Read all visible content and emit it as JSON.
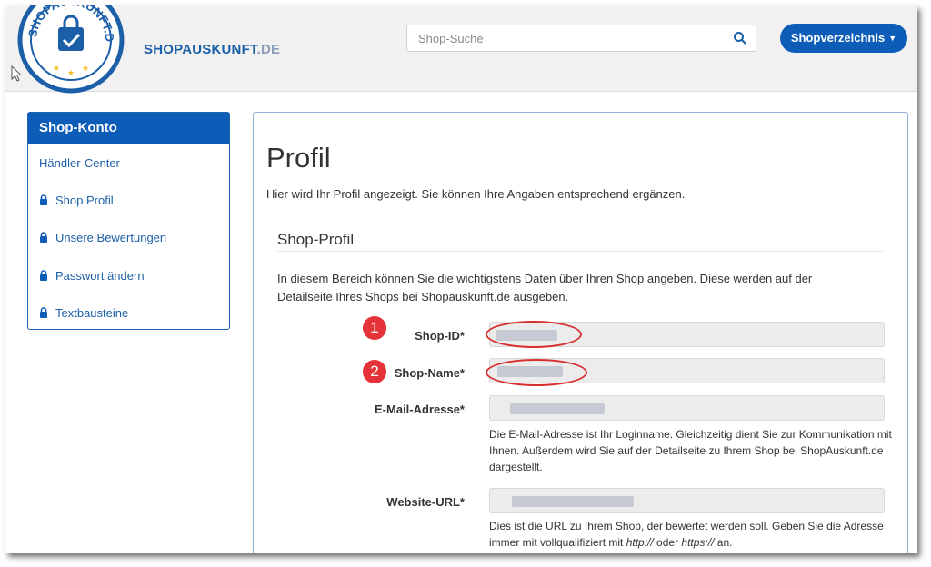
{
  "header": {
    "brand_main": "SHOPAUSKUNFT",
    "brand_tld": ".DE",
    "logo_text": "SHOPAUSKUNFT.DE",
    "search_placeholder": "Shop-Suche",
    "directory_button": "Shopverzeichnis"
  },
  "sidebar": {
    "title": "Shop-Konto",
    "items": [
      {
        "label": "Händler-Center",
        "icon": "none"
      },
      {
        "label": "Shop Profil",
        "icon": "lock-icon"
      },
      {
        "label": "Unsere Bewertungen",
        "icon": "lock-icon"
      },
      {
        "label": "Passwort ändern",
        "icon": "lock-icon"
      },
      {
        "label": "Textbausteine",
        "icon": "lock-icon"
      }
    ]
  },
  "main": {
    "title": "Profil",
    "intro": "Hier wird Ihr Profil angezeigt. Sie können Ihre Angaben entsprechend ergänzen.",
    "section_title": "Shop-Profil",
    "section_desc": "In diesem Bereich können Sie die wichtigstens Daten über Ihren Shop angeben. Diese werden auf der Detailseite Ihres Shops bei Shopauskunft.de ausgeben.",
    "fields": {
      "shop_id": {
        "label": "Shop-ID*",
        "marker": "1"
      },
      "shop_name": {
        "label": "Shop-Name*",
        "marker": "2"
      },
      "email": {
        "label": "E-Mail-Adresse*",
        "help": "Die E-Mail-Adresse ist Ihr Loginname. Gleichzeitig dient Sie zur Kommunikation mit Ihnen. Außerdem wird Sie auf der Detailseite zu Ihrem Shop bei ShopAuskunft.de dargestellt."
      },
      "website": {
        "label": "Website-URL*",
        "help_1": "Dies ist die URL zu Ihrem Shop, der bewertet werden soll. Geben Sie die Adresse immer mit vollqualifiziert mit ",
        "help_http": "http://",
        "help_or": " oder ",
        "help_https": "https://",
        "help_end": " an."
      }
    }
  },
  "colors": {
    "brand_blue": "#0d5db8",
    "marker_red": "#e53238",
    "link_blue": "#1b5fa8"
  }
}
